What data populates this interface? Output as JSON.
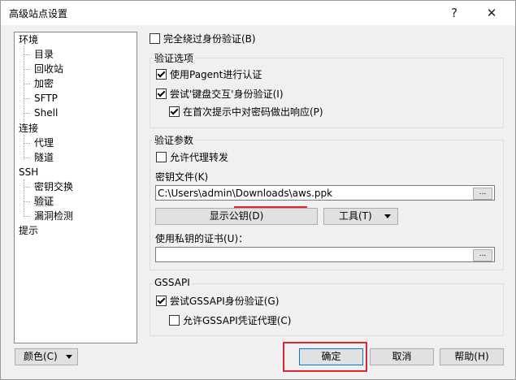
{
  "window": {
    "title": "高级站点设置",
    "help_symbol": "?",
    "close_symbol": "✕"
  },
  "tree": {
    "items": [
      {
        "label": "环境"
      },
      {
        "label": "目录"
      },
      {
        "label": "回收站"
      },
      {
        "label": "加密"
      },
      {
        "label": "SFTP"
      },
      {
        "label": "Shell"
      },
      {
        "label": "连接"
      },
      {
        "label": "代理"
      },
      {
        "label": "隧道"
      },
      {
        "label": "SSH"
      },
      {
        "label": "密钥交换"
      },
      {
        "label": "验证",
        "selected": true
      },
      {
        "label": "漏洞检测"
      },
      {
        "label": "提示"
      }
    ]
  },
  "options": {
    "bypass_auth": {
      "label": "完全绕过身份验证(B)",
      "checked": false
    },
    "auth_options": {
      "title": "验证选项",
      "use_pagent": {
        "label": "使用Pagent进行认证",
        "checked": true
      },
      "try_keyboard": {
        "label": "尝试'键盘交互'身份验证(I)",
        "checked": true
      },
      "respond_first": {
        "label": "在首次提示中对密码做出响应(P)",
        "checked": true
      }
    },
    "auth_params": {
      "title": "验证参数",
      "allow_agent_forward": {
        "label": "允许代理转发",
        "checked": false
      },
      "key_file_label": "密钥文件(K)",
      "key_file_value": "C:\\Users\\admin\\Downloads\\aws.ppk",
      "browse_label": "...",
      "show_public_key": "显示公钥(D)",
      "tools": "工具(T)",
      "cert_label": "使用私钥的证书(U)：",
      "cert_value": "",
      "cert_browse_label": "..."
    },
    "gssapi": {
      "title": "GSSAPI",
      "try_gssapi": {
        "label": "尝试GSSAPI身份验证(G)",
        "checked": true
      },
      "allow_delegation": {
        "label": "允许GSSAPI凭证代理(C)",
        "checked": false
      }
    }
  },
  "footer": {
    "color": "颜色(C)",
    "ok": "确定",
    "cancel": "取消",
    "help": "帮助(H)"
  },
  "colors": {
    "highlight": "#e0252f",
    "focus": "#0078d7"
  }
}
